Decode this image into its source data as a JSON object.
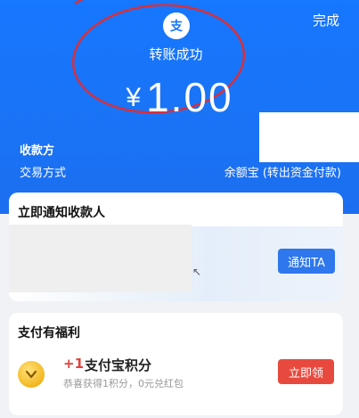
{
  "header": {
    "done_label": "完成",
    "status_text": "转账成功",
    "currency_symbol": "¥",
    "amount": "1.00",
    "logo_char": "支",
    "annotation_color": "#d7303c"
  },
  "details": {
    "payee_label": "收款方",
    "method_label": "交易方式",
    "method_value": "余额宝 (转出资金付款)"
  },
  "notify_card": {
    "title": "立即通知收款人",
    "button_label": "通知TA"
  },
  "benefit_card": {
    "title": "支付有福利",
    "points_prefix": "+1",
    "points_title": "支付宝积分",
    "points_subtitle": "恭喜获得1积分，0元兑红包",
    "claim_label": "立即领",
    "coin_icon": "points-coin-icon"
  },
  "colors": {
    "brand_blue": "#1677ff",
    "button_blue": "#2e77ec",
    "button_red": "#e8493e"
  }
}
